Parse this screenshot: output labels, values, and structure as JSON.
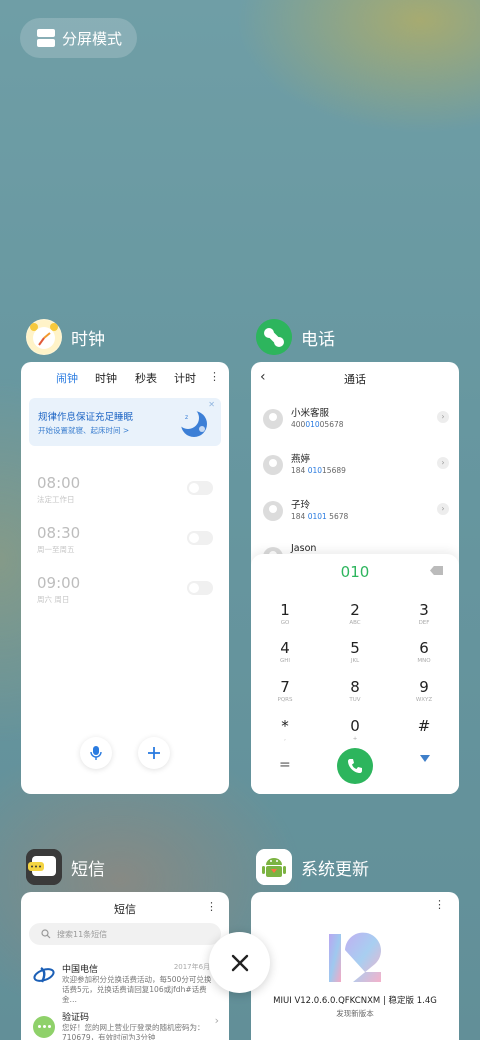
{
  "split_screen": {
    "label": "分屏模式"
  },
  "close_button": {
    "icon": "close-icon"
  },
  "apps": [
    {
      "name": "时钟",
      "icon": "clock-icon"
    },
    {
      "name": "电话",
      "icon": "phone-icon"
    },
    {
      "name": "短信",
      "icon": "messages-icon"
    },
    {
      "name": "系统更新",
      "icon": "android-update-icon"
    }
  ],
  "clock": {
    "tabs": [
      "闹钟",
      "时钟",
      "秒表",
      "计时"
    ],
    "active_tab": "闹钟",
    "banner": {
      "title": "规律作息保证充足睡眠",
      "subtitle": "开始设置就寝、起床时间 >"
    },
    "alarms": [
      {
        "time": "08:00",
        "label": "法定工作日"
      },
      {
        "time": "08:30",
        "label": "周一至周五"
      },
      {
        "time": "09:00",
        "label": "周六 周日"
      }
    ]
  },
  "phone": {
    "title": "通话",
    "contacts": [
      {
        "name": "小米客服",
        "number_pre": "400",
        "number_hl": "010",
        "number_post": "05678"
      },
      {
        "name": "燕婷",
        "number_pre": "184 ",
        "number_hl": "010",
        "number_post": "15689"
      },
      {
        "name": "子玲",
        "number_pre": "184 ",
        "number_hl": "0101",
        "number_post": " 5678"
      },
      {
        "name": "Jason",
        "number_pre": "",
        "number_hl": "",
        "number_post": ""
      }
    ],
    "dialed": "010",
    "keys": [
      {
        "digit": "1",
        "letters": "GO"
      },
      {
        "digit": "2",
        "letters": "ABC"
      },
      {
        "digit": "3",
        "letters": "DEF"
      },
      {
        "digit": "4",
        "letters": "GHI"
      },
      {
        "digit": "5",
        "letters": "JKL"
      },
      {
        "digit": "6",
        "letters": "MNO"
      },
      {
        "digit": "7",
        "letters": "PQRS"
      },
      {
        "digit": "8",
        "letters": "TUV"
      },
      {
        "digit": "9",
        "letters": "WXYZ"
      },
      {
        "digit": "*",
        "letters": ","
      },
      {
        "digit": "0",
        "letters": "+"
      },
      {
        "digit": "#",
        "letters": ""
      }
    ]
  },
  "sms": {
    "title": "短信",
    "search_placeholder": "搜索11条短信",
    "messages": [
      {
        "sender": "中国电信",
        "date": "2017年6月30",
        "body": "欢迎参加积分兑换话费活动，每500分可兑换话费5元，兑换话费请回复106或jfdh#话费金…"
      },
      {
        "sender": "验证码",
        "date": "",
        "body": "您好！您的网上营业厅登录的随机密码为：710679，有效时间为3分钟"
      }
    ]
  },
  "update": {
    "version": "MIUI V12.0.6.0.QFKCNXM | 稳定版 1.4G",
    "subtitle": "发现新版本"
  }
}
